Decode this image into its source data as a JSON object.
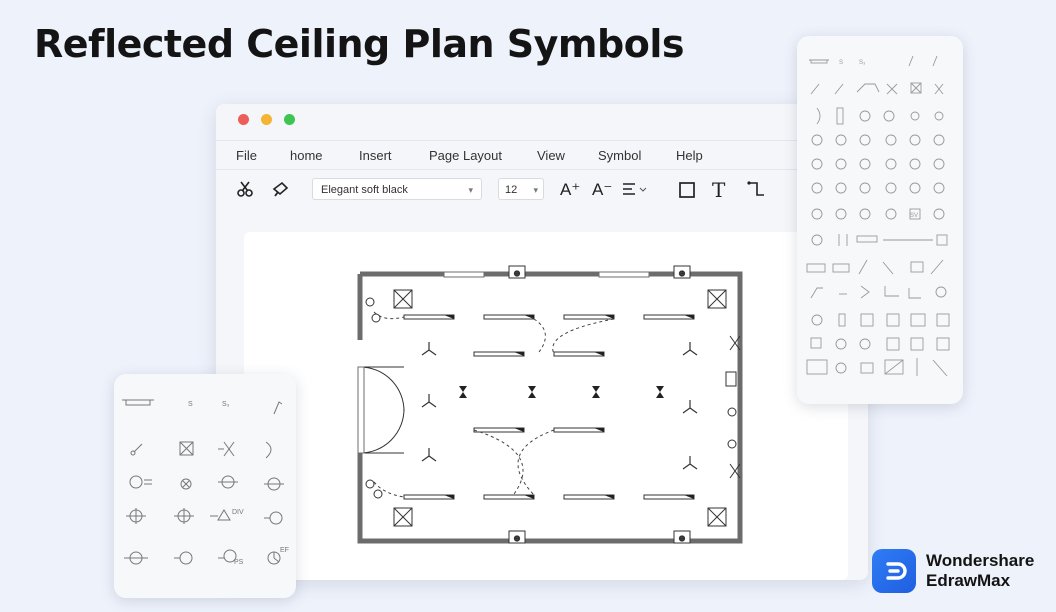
{
  "title": "Reflected Ceiling Plan Symbols",
  "window": {
    "traffic_colors": [
      "#ee5e58",
      "#f5b433",
      "#3dc451"
    ],
    "menu": [
      "File",
      "home",
      "Insert",
      "Page Layout",
      "View",
      "Symbol",
      "Help"
    ],
    "toolbar": {
      "cut_icon": "scissors-icon",
      "format_painter_icon": "brush-icon",
      "font_value": "Elegant soft black",
      "size_value": "12",
      "grow_font": "A⁺",
      "shrink_font": "A⁻",
      "align_icon": "align-icon",
      "rect_icon": "rectangle-icon",
      "text_icon": "T",
      "connector_icon": "connector-icon"
    }
  },
  "left_panel": {
    "row1": [
      "S",
      "S₃"
    ]
  },
  "right_panel": {
    "row1": [
      "S",
      "S₃"
    ]
  },
  "brand": {
    "line1": "Wondershare",
    "line2": "EdrawMax"
  },
  "colors": {
    "background": "#eef2fb",
    "wall": "#6c6c6c",
    "accent": "#2f7df6"
  }
}
